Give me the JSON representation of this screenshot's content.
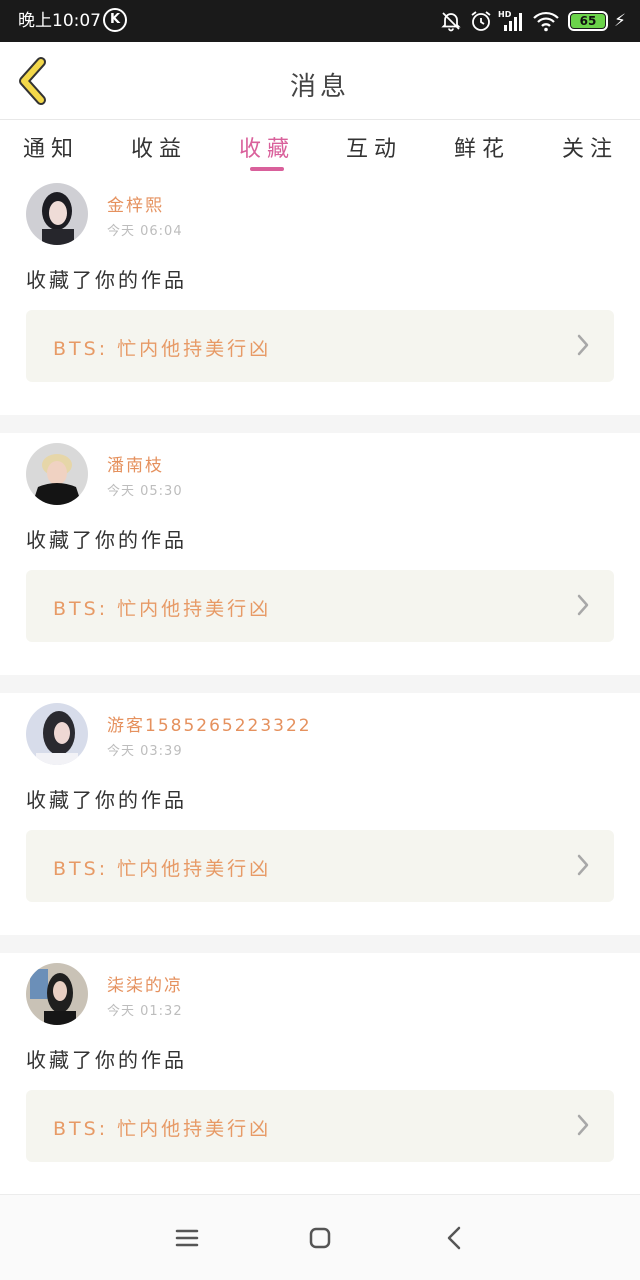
{
  "status_bar": {
    "time": "晚上10:07",
    "app_badge": "K",
    "battery_level": "65",
    "battery_color": "#6bd34a"
  },
  "header": {
    "title": "消息",
    "back_icon": "chevron-left-icon",
    "back_icon_color": "#f3d84a"
  },
  "tabs": [
    {
      "label": "通知",
      "active": false
    },
    {
      "label": "收益",
      "active": false
    },
    {
      "label": "收藏",
      "active": true
    },
    {
      "label": "互动",
      "active": false
    },
    {
      "label": "鲜花",
      "active": false
    },
    {
      "label": "关注",
      "active": false
    }
  ],
  "accent_color": "#d9609b",
  "items": [
    {
      "username": "金梓熙",
      "time": "今天 06:04",
      "action": "收藏了你的作品",
      "work_title": "BTS: 忙内他持美行凶"
    },
    {
      "username": "潘南枝",
      "time": "今天 05:30",
      "action": "收藏了你的作品",
      "work_title": "BTS: 忙内他持美行凶"
    },
    {
      "username": "游客1585265223322",
      "time": "今天 03:39",
      "action": "收藏了你的作品",
      "work_title": "BTS: 忙内他持美行凶"
    },
    {
      "username": "柒柒的凉",
      "time": "今天 01:32",
      "action": "收藏了你的作品",
      "work_title": "BTS: 忙内他持美行凶"
    }
  ],
  "nav": {
    "menu_icon": "menu-icon",
    "home_icon": "home-icon",
    "back_icon": "back-icon"
  }
}
